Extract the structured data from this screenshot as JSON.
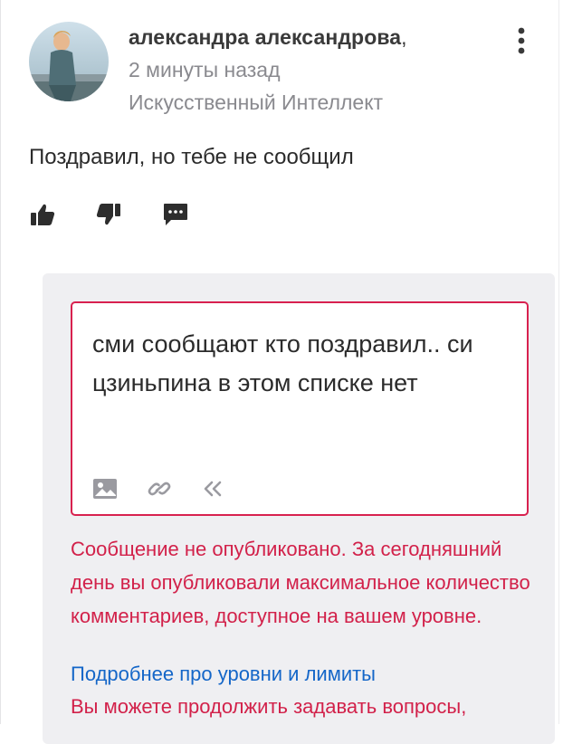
{
  "comment": {
    "author": "александра александрова",
    "author_suffix": ",",
    "time": "2 минуты назад",
    "category": "Искусственный Интеллект",
    "text": "Поздравил, но тебе не сообщил",
    "actions": [
      "like-icon",
      "dislike-icon",
      "reply-icon"
    ],
    "menu_icon": "more-vertical-icon"
  },
  "reply": {
    "text": "сми сообщают кто поздравил.. си цзиньпина в этом списке нет",
    "tools": [
      "image-icon",
      "link-icon",
      "quote-icon"
    ],
    "border_color": "#d8214f"
  },
  "notice": {
    "error_text": "Сообщение не опубликовано. За сегодняшний день вы опубликовали максимальное количество комментариев, доступное на вашем уровне.",
    "link_text": "Подробнее про уровни и лимиты",
    "error_text2": "Вы можете продолжить задавать вопросы,",
    "error_color": "#d2214a",
    "link_color": "#1466c8"
  }
}
